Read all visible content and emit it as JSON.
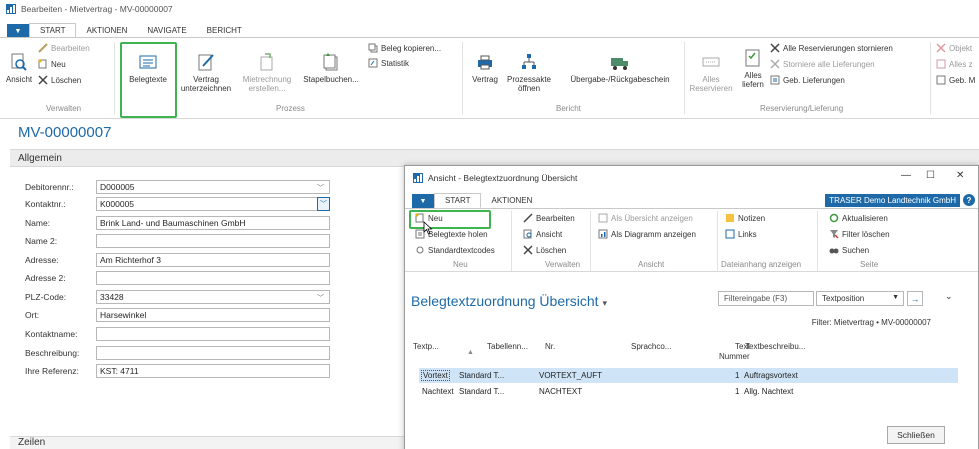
{
  "window": {
    "title": "Bearbeiten - Mietvertrag - MV-00000007"
  },
  "tabs": [
    "START",
    "AKTIONEN",
    "NAVIGATE",
    "BERICHT"
  ],
  "ribbon": {
    "verwalten": {
      "label": "Verwalten",
      "ansicht": "Ansicht",
      "bearbeiten": "Bearbeiten",
      "neu": "Neu",
      "loeschen": "Löschen"
    },
    "belegtexte": "Belegtexte",
    "prozess": {
      "label": "Prozess",
      "vertrag_l1": "Vertrag",
      "vertrag_l2": "unterzeichnen",
      "mietrechnung_l1": "Mietrechnung",
      "mietrechnung_l2": "erstellen...",
      "stapelbuchen": "Stapelbuchen...",
      "beleg_kopieren": "Beleg kopieren...",
      "statistik": "Statistik"
    },
    "bericht": {
      "label": "Bericht",
      "vertrag": "Vertrag",
      "prozessakte_l1": "Prozessakte",
      "prozessakte_l2": "öffnen",
      "uebergabe": "Übergabe-/Rückgabeschein"
    },
    "reservierung": {
      "label": "Reservierung/Lieferung",
      "alles_l1": "Alles",
      "alles_l2": "Reservieren",
      "alles_liefern_l1": "Alles",
      "alles_liefern_l2": "liefern",
      "alle_res_storn": "Alle Reservierungen stornieren",
      "storniere_lief": "Storniere alle Lieferungen",
      "geb_lieferungen": "Geb. Lieferungen"
    },
    "objekt": {
      "objekt": "Objekt",
      "alles_z": "Alles z",
      "geb_m": "Geb. M"
    }
  },
  "page": {
    "title": "MV-00000007",
    "section": "Allgemein",
    "section_zeilen": "Zeilen"
  },
  "fields": [
    {
      "label": "Debitorennr.:",
      "value": "D000005"
    },
    {
      "label": "Kontaktnr.:",
      "value": "K000005"
    },
    {
      "label": "Name:",
      "value": "Brink Land- und Baumaschinen GmbH"
    },
    {
      "label": "Name 2:",
      "value": ""
    },
    {
      "label": "Adresse:",
      "value": "Am Richterhof 3"
    },
    {
      "label": "Adresse 2:",
      "value": ""
    },
    {
      "label": "PLZ-Code:",
      "value": "33428"
    },
    {
      "label": "Ort:",
      "value": "Harsewinkel"
    },
    {
      "label": "Kontaktname:",
      "value": ""
    },
    {
      "label": "Beschreibung:",
      "value": ""
    },
    {
      "label": "Ihre Referenz:",
      "value": "KST: 4711"
    }
  ],
  "dialog": {
    "title": "Ansicht - Belegtextzuordnung Übersicht",
    "tabs": [
      "START",
      "AKTIONEN"
    ],
    "company": "TRASER Demo Landtechnik GmbH",
    "ribbon": {
      "neu_group": "Neu",
      "neu": "Neu",
      "belegtexte_holen": "Belegtexte holen",
      "standardtextcodes": "Standardtextcodes",
      "verwalten_group": "Verwalten",
      "bearbeiten": "Bearbeiten",
      "ansicht": "Ansicht",
      "loeschen": "Löschen",
      "ansicht_group": "Ansicht",
      "als_uebersicht": "Als Übersicht anzeigen",
      "als_diagramm": "Als Diagramm anzeigen",
      "datei_group": "Dateianhang anzeigen",
      "notizen": "Notizen",
      "links": "Links",
      "seite_group": "Seite",
      "aktualisieren": "Aktualisieren",
      "filter_loeschen": "Filter löschen",
      "suchen": "Suchen"
    },
    "list_title": "Belegtextzuordnung Übersicht",
    "filter_placeholder": "Filtereingabe (F3)",
    "filter_field": "Textposition",
    "filter_text": "Filter: Mietvertrag • MV-00000007",
    "columns": [
      "Textp...",
      "Tabellenn...",
      "Nr.",
      "Sprachco...",
      "Text",
      "Nummer",
      "Textbeschreibu..."
    ],
    "rows": [
      {
        "textp": "Vortext",
        "tabelle": "Standard T...",
        "nr": "VORTEXT_AUFT",
        "sprache": "",
        "nummer": "1",
        "beschreibung": "Auftragsvortext"
      },
      {
        "textp": "Nachtext",
        "tabelle": "Standard T...",
        "nr": "NACHTEXT",
        "sprache": "",
        "nummer": "1",
        "beschreibung": "Allg. Nachtext"
      }
    ],
    "close": "Schließen"
  }
}
